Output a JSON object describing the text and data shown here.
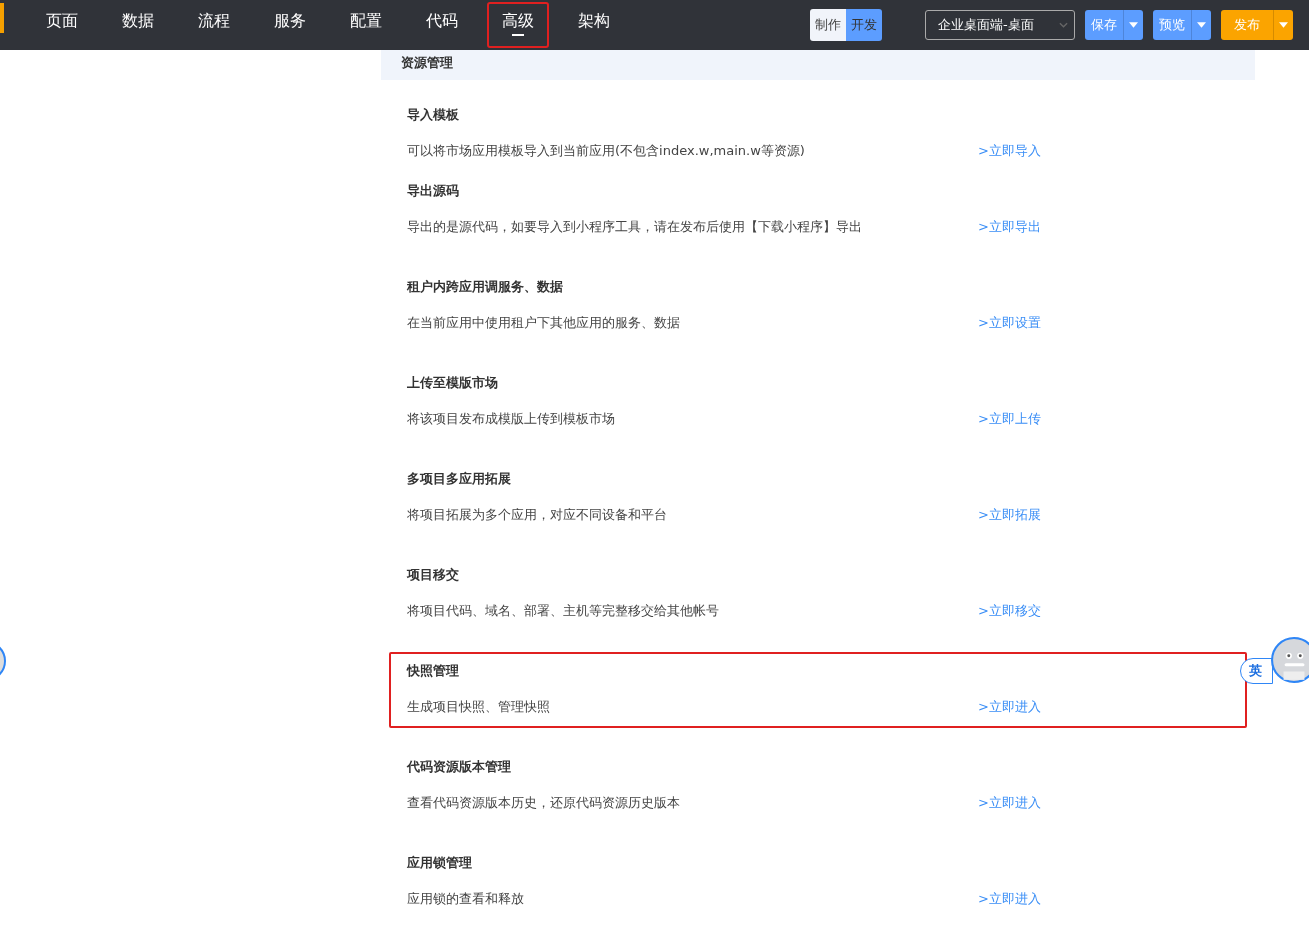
{
  "nav": {
    "tabs": [
      {
        "label": "页面",
        "selected": false,
        "highlighted": false
      },
      {
        "label": "数据",
        "selected": false,
        "highlighted": false
      },
      {
        "label": "流程",
        "selected": false,
        "highlighted": false
      },
      {
        "label": "服务",
        "selected": false,
        "highlighted": false
      },
      {
        "label": "配置",
        "selected": false,
        "highlighted": false
      },
      {
        "label": "代码",
        "selected": false,
        "highlighted": false
      },
      {
        "label": "高级",
        "selected": true,
        "highlighted": true
      },
      {
        "label": "架构",
        "selected": false,
        "highlighted": false
      }
    ],
    "mode_toggle": [
      {
        "label": "制作",
        "selected": false
      },
      {
        "label": "开发",
        "selected": true
      }
    ],
    "target_select": {
      "value": "企业桌面端-桌面"
    },
    "buttons": [
      {
        "label": "保存",
        "kind": "primary"
      },
      {
        "label": "预览",
        "kind": "primary"
      },
      {
        "label": "发布",
        "kind": "warning"
      }
    ]
  },
  "panel": {
    "title": "资源管理",
    "sections": [
      {
        "title": "导入模板",
        "description": "可以将市场应用模板导入到当前应用(不包含index.w,main.w等资源)",
        "action": ">立即导入",
        "highlighted": false
      },
      {
        "title": "导出源码",
        "description": "导出的是源代码，如要导入到小程序工具，请在发布后使用【下载小程序】导出",
        "action": ">立即导出",
        "highlighted": false
      },
      {
        "title": "租户内跨应用调服务、数据",
        "description": "在当前应用中使用租户下其他应用的服务、数据",
        "action": ">立即设置",
        "highlighted": false
      },
      {
        "title": "上传至模版市场",
        "description": "将该项目发布成模版上传到模板市场",
        "action": ">立即上传",
        "highlighted": false
      },
      {
        "title": "多项目多应用拓展",
        "description": "将项目拓展为多个应用，对应不同设备和平台",
        "action": ">立即拓展",
        "highlighted": false
      },
      {
        "title": "项目移交",
        "description": "将项目代码、域名、部署、主机等完整移交给其他帐号",
        "action": ">立即移交",
        "highlighted": false
      },
      {
        "title": "快照管理",
        "description": "生成项目快照、管理快照",
        "action": ">立即进入",
        "highlighted": true
      },
      {
        "title": "代码资源版本管理",
        "description": "查看代码资源版本历史，还原代码资源历史版本",
        "action": ">立即进入",
        "highlighted": false
      },
      {
        "title": "应用锁管理",
        "description": "应用锁的查看和释放",
        "action": ">立即进入",
        "highlighted": false
      }
    ]
  },
  "ime_widget": {
    "label": "英"
  }
}
